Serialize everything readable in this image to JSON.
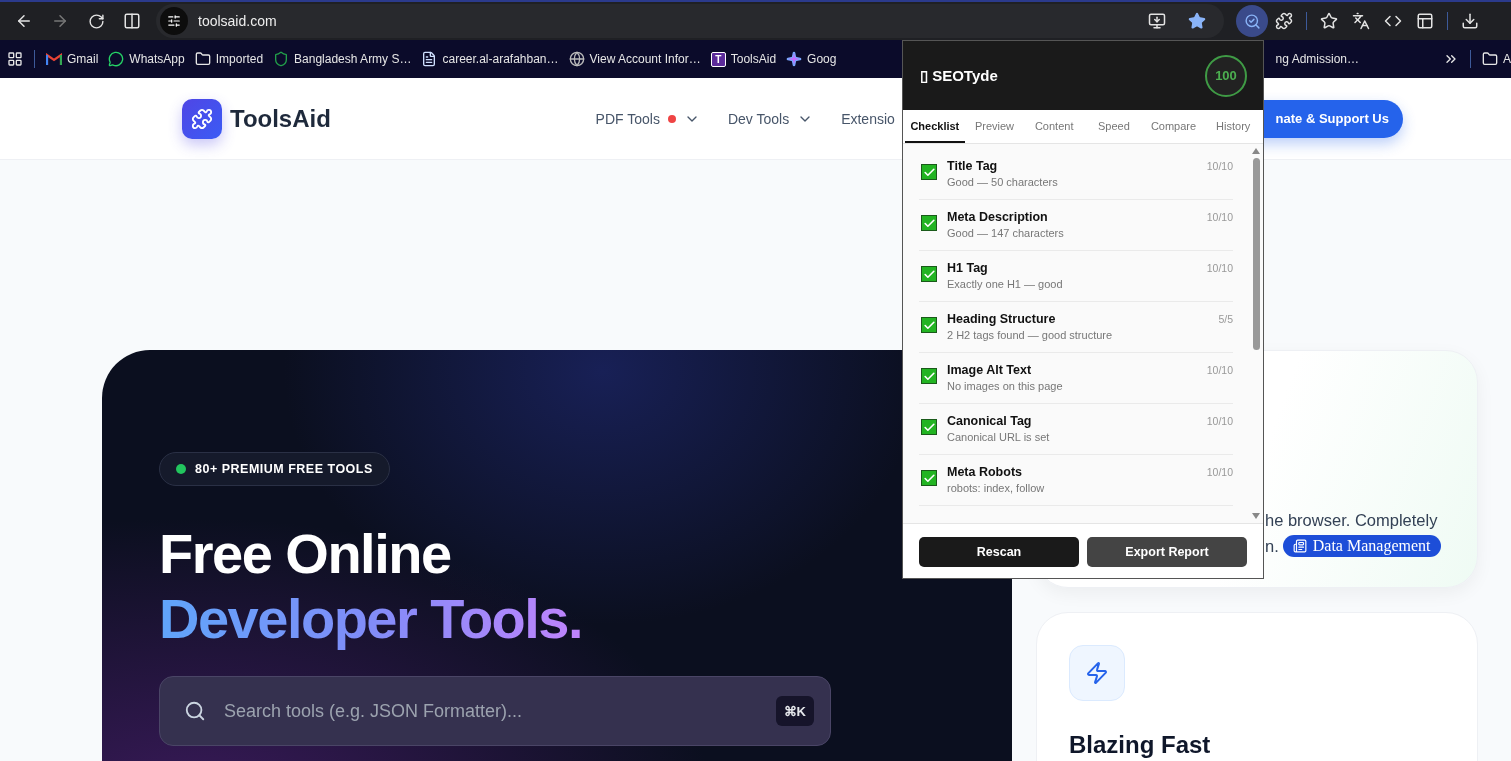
{
  "browser": {
    "url": "toolsaid.com",
    "bookmarks": [
      {
        "label": "Gmail",
        "kind": "gmail"
      },
      {
        "label": "WhatsApp",
        "kind": "whatsapp"
      },
      {
        "label": "Imported",
        "kind": "folder"
      },
      {
        "label": "Bangladesh Army S…",
        "kind": "emblem"
      },
      {
        "label": "career.al-arafahban…",
        "kind": "doc"
      },
      {
        "label": "View Account Infor…",
        "kind": "globe"
      },
      {
        "label": "ToolsAid",
        "kind": "letter",
        "letter": "T"
      },
      {
        "label": "Goog",
        "kind": "spark"
      }
    ],
    "bookmark_cut": "ng Admission…",
    "other_bookmarks": "A"
  },
  "site": {
    "logo": "ToolsAid",
    "nav": [
      {
        "label": "PDF Tools",
        "dot": true,
        "dropdown": true
      },
      {
        "label": "Dev Tools",
        "dot": false,
        "dropdown": true
      },
      {
        "label": "Extensio",
        "dot": false,
        "dropdown": false
      }
    ],
    "cta": "nate & Support Us",
    "hero": {
      "badge": "80+ PREMIUM FREE TOOLS",
      "title": "Free Online",
      "title_accent": "Developer Tools.",
      "search_placeholder": "Search tools (e.g. JSON Formatter)...",
      "shortcut": "⌘K"
    },
    "card": {
      "lines": [
        "he browser. Completely",
        "n."
      ],
      "chip": "Data Management"
    },
    "feature": {
      "title": "Blazing Fast"
    }
  },
  "popup": {
    "title": "▯ SEOTyde",
    "score": "100",
    "tabs": [
      {
        "label": "Checklist",
        "selected": true
      },
      {
        "label": "Preview",
        "selected": false
      },
      {
        "label": "Content",
        "selected": false
      },
      {
        "label": "Speed",
        "selected": false
      },
      {
        "label": "Compare",
        "selected": false
      },
      {
        "label": "History",
        "selected": false
      }
    ],
    "checks": [
      {
        "title": "Title Tag",
        "detail": "Good — 50 characters",
        "score": "10/10",
        "checked": true
      },
      {
        "title": "Meta Description",
        "detail": "Good — 147 characters",
        "score": "10/10",
        "checked": true
      },
      {
        "title": "H1 Tag",
        "detail": "Exactly one H1 — good",
        "score": "10/10",
        "checked": true
      },
      {
        "title": "Heading Structure",
        "detail": "2 H2 tags found — good structure",
        "score": "5/5",
        "checked": true
      },
      {
        "title": "Image Alt Text",
        "detail": "No images on this page",
        "score": "10/10",
        "checked": true
      },
      {
        "title": "Canonical Tag",
        "detail": "Canonical URL is set",
        "score": "10/10",
        "checked": true
      },
      {
        "title": "Meta Robots",
        "detail": "robots: index, follow",
        "score": "10/10",
        "checked": true
      }
    ],
    "buttons": [
      "Rescan",
      "Export Report"
    ]
  }
}
